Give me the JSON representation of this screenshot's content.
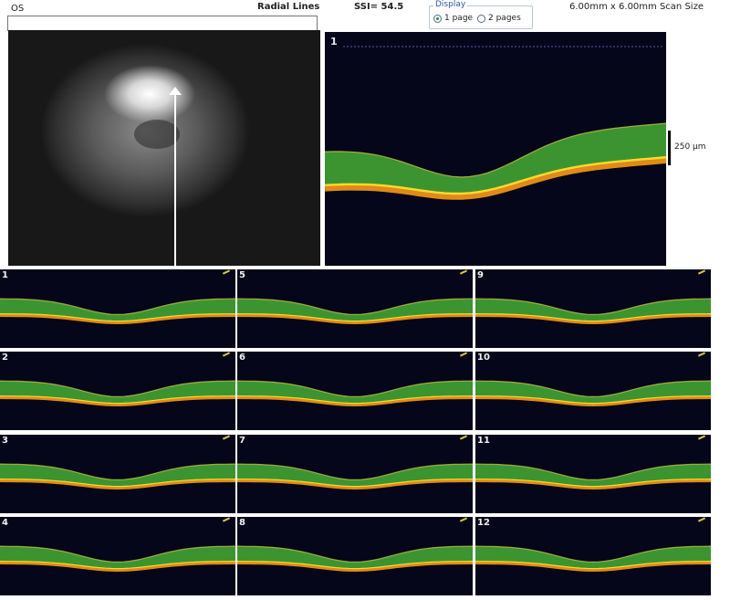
{
  "header": {
    "eye": "OS",
    "pattern": "Radial Lines",
    "ssi": "SSI= 54.5",
    "scan_size": "6.00mm x 6.00mm Scan Size"
  },
  "display": {
    "legend": "Display",
    "option_1": "1 page",
    "option_2": "2 pages",
    "selected": "1 page"
  },
  "main_scan": {
    "number": "1",
    "scale_label": "250 µm"
  },
  "tiles": [
    "1",
    "2",
    "3",
    "4",
    "5",
    "6",
    "7",
    "8",
    "9",
    "10",
    "11",
    "12"
  ],
  "colors": {
    "background": "#06061a",
    "rpe": "#e08a1a",
    "retina": "#4fc43a",
    "highlight": "#ffee33"
  }
}
